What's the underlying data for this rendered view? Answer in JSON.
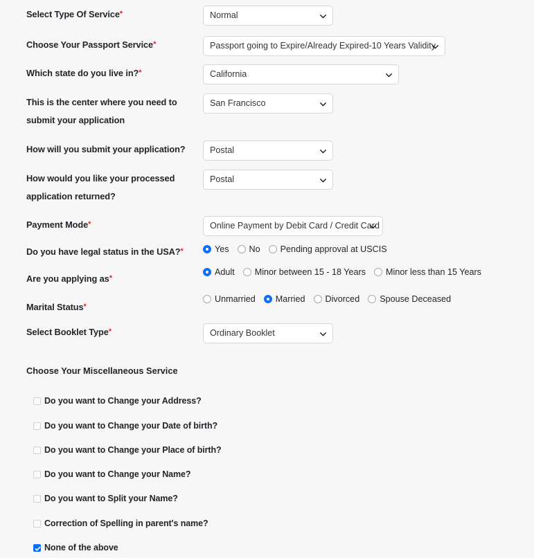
{
  "form": {
    "fields": [
      {
        "label": "Select Type Of Service",
        "required": true,
        "control": "select",
        "value": "Normal"
      },
      {
        "label": "Choose Your Passport Service",
        "required": true,
        "control": "select",
        "value": "Passport going to Expire/Already Expired-10 Years Validity"
      },
      {
        "label": "Which state do you live in?",
        "required": true,
        "control": "select",
        "value": "California"
      },
      {
        "label": "This is the center where you need to submit your application",
        "required": false,
        "control": "select",
        "value": "San Francisco"
      },
      {
        "label": "How will you submit your application?",
        "required": false,
        "control": "select",
        "value": "Postal"
      },
      {
        "label": "How would you like your processed application returned?",
        "required": false,
        "control": "select",
        "value": "Postal"
      },
      {
        "label": "Payment Mode",
        "required": true,
        "control": "select",
        "value": "Online Payment by Debit Card / Credit Card"
      },
      {
        "label": "Do you have legal status in the USA?",
        "required": true,
        "control": "radio",
        "options": [
          {
            "label": "Yes",
            "checked": true
          },
          {
            "label": "No",
            "checked": false
          },
          {
            "label": "Pending approval at USCIS",
            "checked": false
          }
        ]
      },
      {
        "label": "Are you applying as",
        "required": true,
        "control": "radio",
        "options": [
          {
            "label": "Adult",
            "checked": true
          },
          {
            "label": "Minor between 15 - 18 Years",
            "checked": false
          },
          {
            "label": "Minor less than 15 Years",
            "checked": false
          }
        ]
      },
      {
        "label": "Marital Status",
        "required": true,
        "control": "radio",
        "options": [
          {
            "label": "Unmarried",
            "checked": false
          },
          {
            "label": "Married",
            "checked": true
          },
          {
            "label": "Divorced",
            "checked": false
          },
          {
            "label": "Spouse Deceased",
            "checked": false
          }
        ]
      },
      {
        "label": "Select Booklet Type",
        "required": true,
        "control": "select",
        "value": "Ordinary Booklet"
      }
    ],
    "miscellaneous": {
      "heading": "Choose Your Miscellaneous Service",
      "options": [
        {
          "label": "Do you want to Change your Address?",
          "checked": false
        },
        {
          "label": "Do you want to Change your Date of birth?",
          "checked": false
        },
        {
          "label": "Do you want to Change your Place of birth?",
          "checked": false
        },
        {
          "label": "Do you want to Change your Name?",
          "checked": false
        },
        {
          "label": "Do you want to Split your Name?",
          "checked": false
        },
        {
          "label": "Correction of Spelling in parent's name?",
          "checked": false
        },
        {
          "label": "None of the above",
          "checked": true
        }
      ]
    },
    "icons": {
      "select_caret": "chevron-down-icon",
      "checkbox_check": "check-icon"
    },
    "colors": {
      "page_background": "#f7f7f7",
      "text": "#212529",
      "required_asterisk": "#e0252b",
      "accent_selected": "#0d6efd",
      "control_border": "#d5d7da",
      "control_background": "#ffffff"
    }
  }
}
